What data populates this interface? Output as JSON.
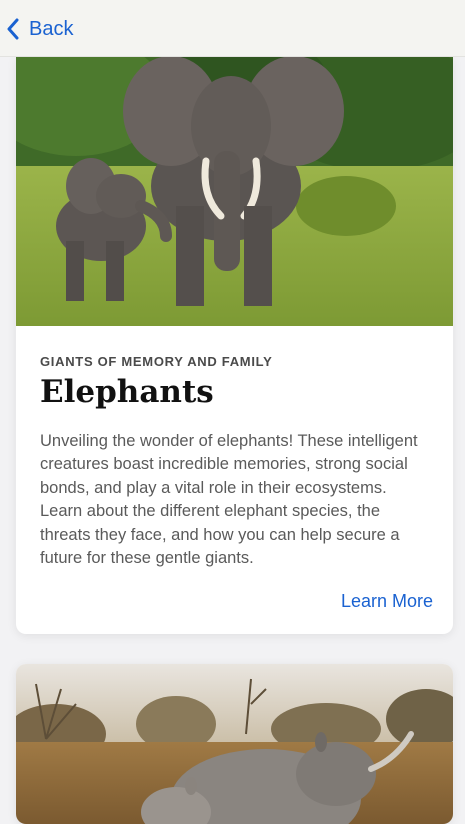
{
  "nav": {
    "back_label": "Back",
    "back_icon": "chevron-left-icon",
    "accent_color": "#1a62d1"
  },
  "cards": [
    {
      "image": "elephants-photo",
      "eyebrow": "GIANTS OF MEMORY AND FAMILY",
      "title": "Elephants",
      "description": "Unveiling the wonder of elephants! These intelligent creatures boast incredible memories, strong social bonds, and play a vital role in their ecosystems. Learn about the different elephant species, the threats they face, and how you can help secure a future for these gentle giants.",
      "cta_label": "Learn More"
    },
    {
      "image": "rhinos-photo"
    }
  ]
}
